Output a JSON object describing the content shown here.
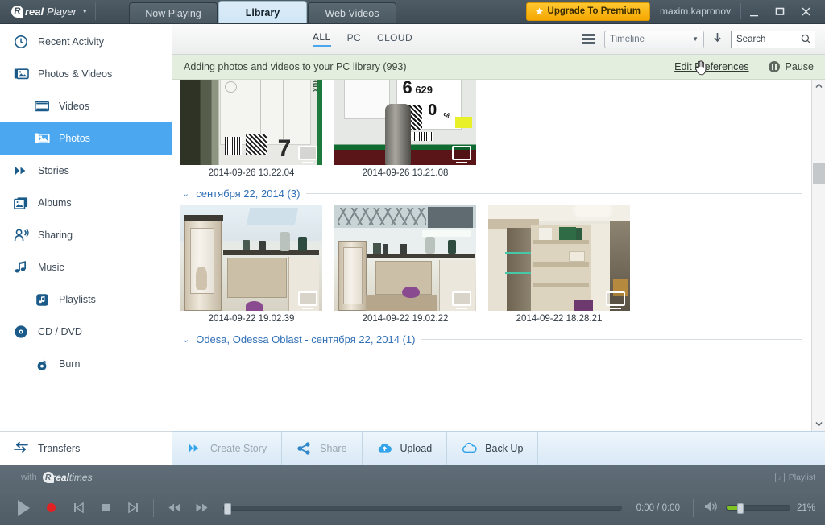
{
  "titlebar": {
    "brand": {
      "real": "real",
      "player": "Player",
      "caret": "▾"
    },
    "tabs": [
      {
        "label": "Now Playing",
        "active": false
      },
      {
        "label": "Library",
        "active": true
      },
      {
        "label": "Web Videos",
        "active": false
      }
    ],
    "upgrade_label": "Upgrade To Premium",
    "upgrade_star": "★",
    "username": "maxim.kapronov",
    "window_controls": {
      "minimize": "_",
      "maximize": "▭",
      "close": "✕"
    }
  },
  "sidebar": {
    "items": [
      {
        "label": "Recent Activity",
        "icon": "clock-icon",
        "sub": false,
        "selected": false
      },
      {
        "label": "Photos & Videos",
        "icon": "photos-videos-icon",
        "sub": false,
        "selected": false
      },
      {
        "label": "Videos",
        "icon": "film-icon",
        "sub": true,
        "selected": false
      },
      {
        "label": "Photos",
        "icon": "photos-icon",
        "sub": true,
        "selected": true
      },
      {
        "label": "Stories",
        "icon": "stories-icon",
        "sub": false,
        "selected": false
      },
      {
        "label": "Albums",
        "icon": "albums-icon",
        "sub": false,
        "selected": false
      },
      {
        "label": "Sharing",
        "icon": "sharing-icon",
        "sub": false,
        "selected": false
      },
      {
        "label": "Music",
        "icon": "music-note-icon",
        "sub": false,
        "selected": false
      },
      {
        "label": "Playlists",
        "icon": "playlist-icon",
        "sub": true,
        "selected": false
      },
      {
        "label": "CD / DVD",
        "icon": "disc-icon",
        "sub": false,
        "selected": false
      },
      {
        "label": "Burn",
        "icon": "burn-icon",
        "sub": true,
        "selected": false
      }
    ],
    "footer": {
      "label": "Transfers",
      "icon": "transfers-icon"
    }
  },
  "toolbar": {
    "filters": [
      {
        "label": "ALL",
        "active": true
      },
      {
        "label": "PC",
        "active": false
      },
      {
        "label": "CLOUD",
        "active": false
      }
    ],
    "list_view_icon": "list-view-icon",
    "sort_select": {
      "value": "Timeline",
      "caret": "▼"
    },
    "sort_direction_icon": "arrow-down-icon",
    "search": {
      "value": "",
      "placeholder": "Search",
      "icon": "search-icon"
    }
  },
  "notice": {
    "message": "Adding photos and videos to your PC library (993)",
    "edit_preferences": "Edit Preferences",
    "pause_label": "Pause",
    "pause_icon": "pause-circle-icon",
    "background_color": "#e3eede"
  },
  "grid": {
    "rows": [
      {
        "group_header": null,
        "items": [
          {
            "caption": "2014-09-26 13.22.04",
            "art": "appliance-label",
            "badge": "pc-badge"
          },
          {
            "caption": "2014-09-26 13.21.08",
            "art": "price-tag",
            "badge": "pc-badge"
          }
        ]
      }
    ],
    "group_headers": [
      {
        "chevron": "⌄",
        "label": "сентября 22, 2014 (3)"
      },
      {
        "chevron": "⌄",
        "label": "Odesa, Odessa Oblast - сентября 22, 2014 (1)"
      }
    ],
    "row2": [
      {
        "caption": "2014-09-22 19.02.39",
        "art": "showroom-a",
        "badge": "pc-badge"
      },
      {
        "caption": "2014-09-22 19.02.22",
        "art": "showroom-b",
        "badge": "pc-badge"
      },
      {
        "caption": "2014-09-22 18.28.21",
        "art": "showroom-c",
        "badge": "pc-badge"
      }
    ],
    "scrollbar": {
      "up": "︿",
      "down": "﹀"
    }
  },
  "actionbar": {
    "actions": [
      {
        "label": "Create Story",
        "icon": "story-icon",
        "disabled": true
      },
      {
        "label": "Share",
        "icon": "share-icon",
        "disabled": true
      },
      {
        "label": "Upload",
        "icon": "upload-cloud-icon",
        "disabled": false
      },
      {
        "label": "Back Up",
        "icon": "backup-cloud-icon",
        "disabled": false
      }
    ]
  },
  "player": {
    "branding": {
      "with": "with",
      "real": "real",
      "times": "times"
    },
    "playlist_label": "Playlist",
    "playlist_icon": "playlist-note-icon",
    "controls": [
      {
        "name": "play-button",
        "icon": "play-icon"
      },
      {
        "name": "record-button",
        "icon": "record-icon"
      },
      {
        "name": "previous-button",
        "icon": "previous-icon"
      },
      {
        "name": "stop-button",
        "icon": "stop-icon"
      },
      {
        "name": "next-button",
        "icon": "next-icon"
      },
      {
        "name": "rewind-button",
        "icon": "rewind-icon"
      },
      {
        "name": "fast-forward-button",
        "icon": "fast-forward-icon"
      }
    ],
    "time": "0:00 / 0:00",
    "volume_percent": "21%",
    "volume_icon": "speaker-icon",
    "seek_position": 0,
    "volume_value": 21
  },
  "colors": {
    "accent_blue": "#4aa7f0",
    "titlebar": "#4a5862",
    "upgrade_gold": "#f5a700",
    "notice_green": "#e3eede",
    "link_blue": "#2f6fb5",
    "volume_green": "#7ec224",
    "record_red": "#e02222"
  }
}
